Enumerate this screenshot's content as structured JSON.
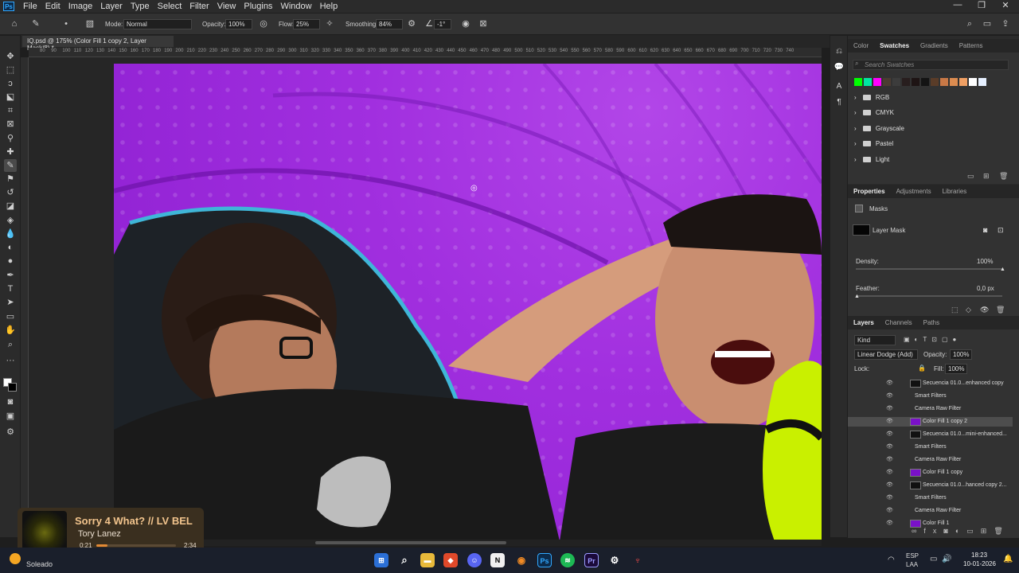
{
  "menubar": {
    "logo": "Ps",
    "items": [
      "File",
      "Edit",
      "Image",
      "Layer",
      "Type",
      "Select",
      "Filter",
      "View",
      "Plugins",
      "Window",
      "Help"
    ],
    "window_controls": [
      "—",
      "❐",
      "✕"
    ]
  },
  "options": {
    "mode_label": "Mode:",
    "mode_value": "Normal",
    "opacity_label": "Opacity:",
    "opacity_value": "100%",
    "flow_label": "Flow:",
    "flow_value": "25%",
    "smoothing_label": "Smoothing:",
    "smoothing_value": "84%",
    "angle_value": "-1°"
  },
  "document": {
    "tab_title": "IQ.psd @ 175% (Color Fill 1 copy 2, Layer Mask/8) *"
  },
  "ruler": {
    "ticks": [
      "80",
      "90",
      "100",
      "110",
      "120",
      "130",
      "140",
      "150",
      "160",
      "170",
      "180",
      "190",
      "200",
      "210",
      "220",
      "230",
      "240",
      "250",
      "260",
      "270",
      "280",
      "290",
      "300",
      "310",
      "320",
      "330",
      "340",
      "350",
      "360",
      "370",
      "380",
      "390",
      "400",
      "410",
      "420",
      "430",
      "440",
      "450",
      "460",
      "470",
      "480",
      "490",
      "500",
      "510",
      "520",
      "530",
      "540",
      "550",
      "560",
      "570",
      "580",
      "590",
      "600",
      "610",
      "620",
      "630",
      "640",
      "650",
      "660",
      "670",
      "680",
      "690",
      "700",
      "710",
      "720",
      "730",
      "740"
    ]
  },
  "swatches_panel": {
    "tabs": [
      "Color",
      "Swatches",
      "Gradients",
      "Patterns"
    ],
    "active_tab": "Swatches",
    "search_placeholder": "Search Swatches",
    "colors": [
      "#00ff00",
      "#00e6a0",
      "#ff00ff",
      "#4b3c32",
      "#3c3c3c",
      "#281e1e",
      "#1e1414",
      "#141414",
      "#5a3c28",
      "#c87846",
      "#dc8c50",
      "#f0a064",
      "#ffffff",
      "#e6f0ff"
    ],
    "folders": [
      "RGB",
      "CMYK",
      "Grayscale",
      "Pastel",
      "Light"
    ]
  },
  "properties_panel": {
    "tabs": [
      "Properties",
      "Adjustments",
      "Libraries"
    ],
    "active_tab": "Properties",
    "section": "Masks",
    "mask_name": "Layer Mask",
    "density_label": "Density:",
    "density_value": "100%",
    "feather_label": "Feather:",
    "feather_value": "0,0 px"
  },
  "layers_panel": {
    "tabs": [
      "Layers",
      "Channels",
      "Paths"
    ],
    "active_tab": "Layers",
    "filter_kind": "Kind",
    "blend_mode": "Linear Dodge (Add)",
    "opacity_label": "Opacity:",
    "opacity_value": "100%",
    "lock_label": "Lock:",
    "fill_label": "Fill:",
    "fill_value": "100%",
    "layers": [
      {
        "name": "Secuencia 01.0...enhanced copy",
        "type": "smart",
        "selected": false
      },
      {
        "name": "Smart Filters",
        "type": "sub",
        "selected": false
      },
      {
        "name": "Camera Raw Filter",
        "type": "sub",
        "selected": false
      },
      {
        "name": "Color Fill 1 copy 2",
        "type": "fill",
        "selected": true
      },
      {
        "name": "Secuencia 01.0...mini-enhanced...",
        "type": "smart",
        "selected": false
      },
      {
        "name": "Smart Filters",
        "type": "sub",
        "selected": false
      },
      {
        "name": "Camera Raw Filter",
        "type": "sub",
        "selected": false
      },
      {
        "name": "Color Fill 1 copy",
        "type": "fill",
        "selected": false
      },
      {
        "name": "Secuencia 01.0...hanced copy 2...",
        "type": "smart",
        "selected": false
      },
      {
        "name": "Smart Filters",
        "type": "sub",
        "selected": false
      },
      {
        "name": "Camera Raw Filter",
        "type": "sub",
        "selected": false
      },
      {
        "name": "Color Fill 1",
        "type": "fill",
        "selected": false
      }
    ]
  },
  "media_widget": {
    "title": "Sorry 4 What? // LV BEL",
    "artist": "Tory Lanez",
    "elapsed": "0:21",
    "duration": "2:34",
    "progress": 0.136
  },
  "taskbar": {
    "weather_text": "Soleado",
    "apps": [
      "start",
      "search",
      "file-explorer",
      "brave",
      "discord",
      "notion",
      "blender",
      "photoshop",
      "spotify",
      "premiere",
      "app",
      "app2"
    ],
    "lang_primary": "ESP",
    "lang_secondary": "LAA",
    "time": "18:23",
    "date": "10-01-2026"
  }
}
